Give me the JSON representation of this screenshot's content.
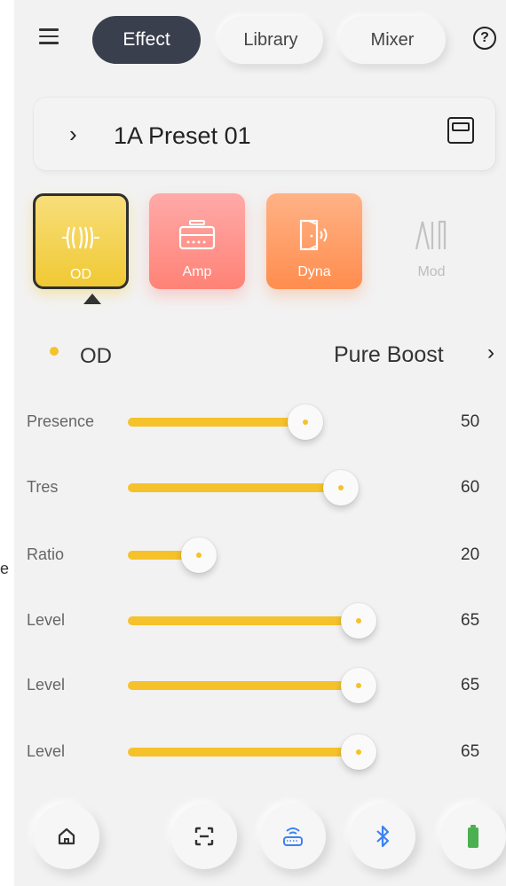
{
  "stray_text": "e",
  "topbar": {
    "tabs": [
      {
        "label": "Effect",
        "active": true
      },
      {
        "label": "Library",
        "active": false
      },
      {
        "label": "Mixer",
        "active": false
      }
    ],
    "menu_icon": "hamburger-menu-icon",
    "help_icon": "question-circle-icon"
  },
  "preset": {
    "name": "1A Preset 01",
    "chevron_icon": "chevron-right-icon",
    "save_icon": "save-floppy-icon"
  },
  "effects": [
    {
      "label": "OD",
      "icon": "overdrive-waveform-icon",
      "selected": true,
      "color": "#f0c934"
    },
    {
      "label": "Amp",
      "icon": "amplifier-icon",
      "selected": false,
      "color": "#ff8276"
    },
    {
      "label": "Dyna",
      "icon": "door-sound-icon",
      "selected": false,
      "color": "#ff8d4e"
    },
    {
      "label": "Mod",
      "icon": "modulation-wave-icon",
      "selected": false,
      "color": "#bdbdbd"
    }
  ],
  "effect_header": {
    "name": "OD",
    "preset_type": "Pure Boost",
    "chevron_icon": "chevron-right-icon"
  },
  "params": [
    {
      "label": "Presence",
      "value": "50",
      "fill": 0.5
    },
    {
      "label": "Tres",
      "value": "60",
      "fill": 0.6
    },
    {
      "label": "Ratio",
      "value": "20",
      "fill": 0.2
    },
    {
      "label": "Level",
      "value": "65",
      "fill": 0.65
    },
    {
      "label": "Level",
      "value": "65",
      "fill": 0.65
    },
    {
      "label": "Level",
      "value": "65",
      "fill": 0.65
    }
  ],
  "accent_color": "#f5c22b",
  "bottom_bar": [
    {
      "icon": "home-icon"
    },
    {
      "icon": "scan-icon"
    },
    {
      "icon": "router-icon"
    },
    {
      "icon": "bluetooth-icon"
    },
    {
      "icon": "battery-icon"
    }
  ]
}
